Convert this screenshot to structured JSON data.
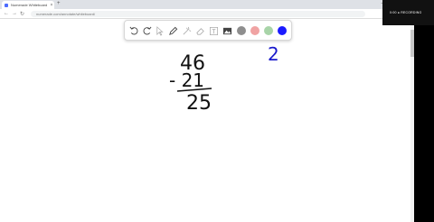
{
  "browser": {
    "tab_title": "Numerade Whiteboard",
    "tab_close": "×",
    "newtab": "+",
    "win_min": "–",
    "win_max": "▢",
    "win_close": "×",
    "url": "numerade.com/annotate/whiteboard/",
    "back": "←",
    "forward": "→",
    "reload": "↻",
    "menu": "⋮"
  },
  "toolbar": {
    "tools": [
      {
        "name": "undo-icon"
      },
      {
        "name": "redo-icon"
      },
      {
        "name": "pointer-icon"
      },
      {
        "name": "pen-icon"
      },
      {
        "name": "laser-icon"
      },
      {
        "name": "eraser-icon"
      },
      {
        "name": "text-icon"
      },
      {
        "name": "image-icon"
      }
    ],
    "colors": [
      "#8e8e8e",
      "#f0a3a3",
      "#a8d4a8",
      "#1a1aff"
    ],
    "selected_color": "#1a1aff"
  },
  "whiteboard": {
    "handwriting": {
      "top_number": "46",
      "minus_line": "- 21",
      "result": "25",
      "side_note": "2"
    }
  },
  "recording": {
    "label": "REC",
    "status_text": "0:00 ● RECORDING"
  }
}
